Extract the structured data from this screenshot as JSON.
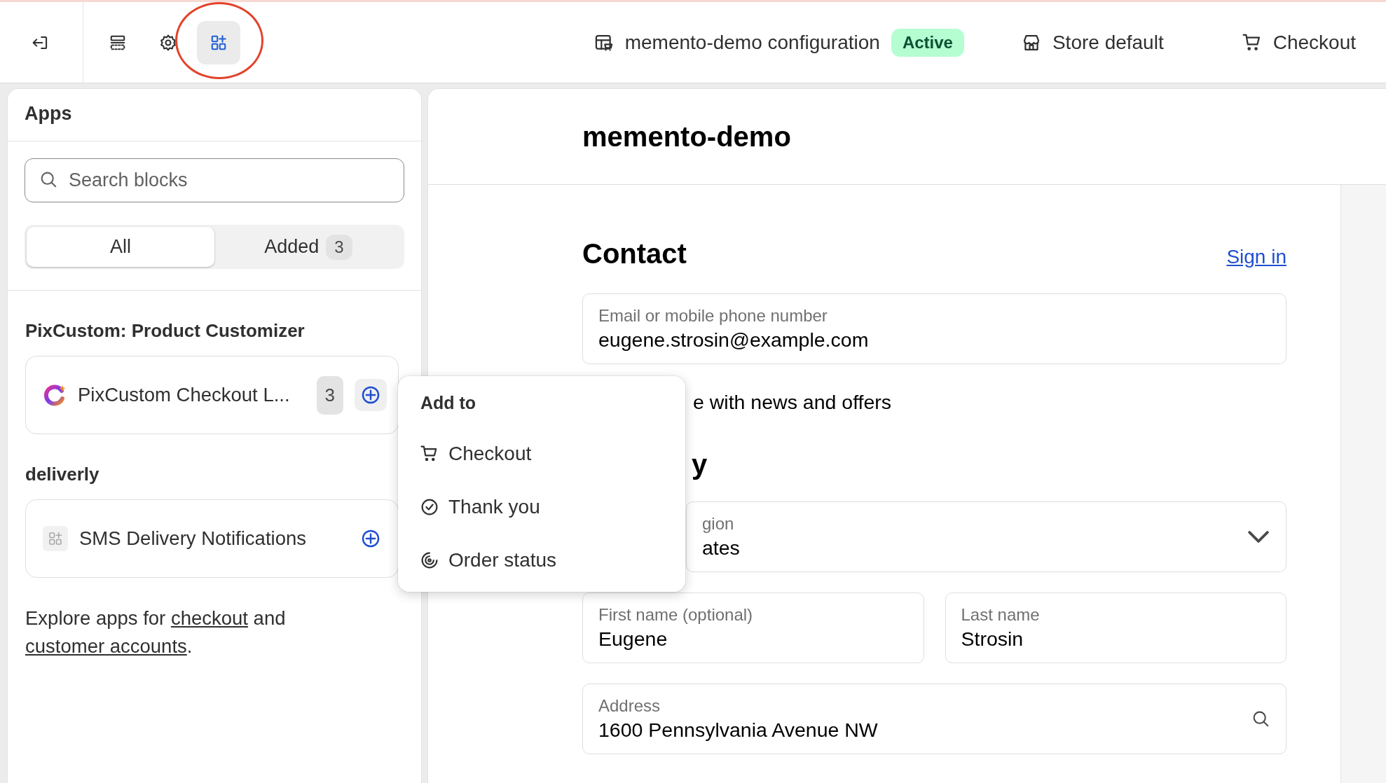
{
  "toolbar": {
    "buttons": [
      {
        "kind": "exit",
        "selected": false
      },
      {
        "kind": "sections",
        "selected": false
      },
      {
        "kind": "settings",
        "selected": false
      },
      {
        "kind": "apps",
        "selected": true
      }
    ],
    "circle_selected": true,
    "configuration": {
      "name": "memento-demo configuration",
      "status": "Active"
    },
    "store": "Store default",
    "page": "Checkout"
  },
  "sidebar": {
    "title": "Apps",
    "search": {
      "placeholder": "Search blocks"
    },
    "filters": [
      {
        "label": "All",
        "selected": true
      },
      {
        "label": "Added",
        "count": "3",
        "selected": false
      }
    ],
    "groups": [
      {
        "name": "PixCustom: Product Customizer",
        "blocks": [
          {
            "kind": "logo",
            "name": "PixCustom Checkout L...",
            "count": "3",
            "add_active": true
          }
        ]
      },
      {
        "name": "deliverly",
        "blocks": [
          {
            "kind": "generic",
            "name": "SMS Delivery Notifications",
            "add_active": false
          }
        ]
      }
    ],
    "footer": [
      {
        "kind": "text",
        "text": "Explore apps for "
      },
      {
        "kind": "link",
        "text": "checkout"
      },
      {
        "kind": "text",
        "text": " and "
      },
      {
        "kind": "link",
        "text": "customer accounts"
      },
      {
        "kind": "text",
        "text": "."
      }
    ]
  },
  "preview": {
    "title": "memento-demo",
    "contact": {
      "heading": "Contact",
      "sign_in": "Sign in",
      "email": {
        "label": "Email or mobile phone number",
        "value": "eugene.strosin@example.com"
      },
      "newsletter": "e with news and offers"
    },
    "delivery": {
      "heading": "y",
      "country": {
        "label": "gion",
        "value": "ates"
      },
      "first_name": {
        "label": "First name (optional)",
        "value": "Eugene"
      },
      "last_name": {
        "label": "Last name",
        "value": "Strosin"
      },
      "address": {
        "label": "Address",
        "value": "1600 Pennsylvania Avenue NW"
      }
    }
  },
  "popup": {
    "title": "Add to",
    "items": [
      {
        "kind": "cart",
        "label": "Checkout"
      },
      {
        "kind": "check",
        "label": "Thank you"
      },
      {
        "kind": "status",
        "label": "Order status"
      }
    ]
  }
}
